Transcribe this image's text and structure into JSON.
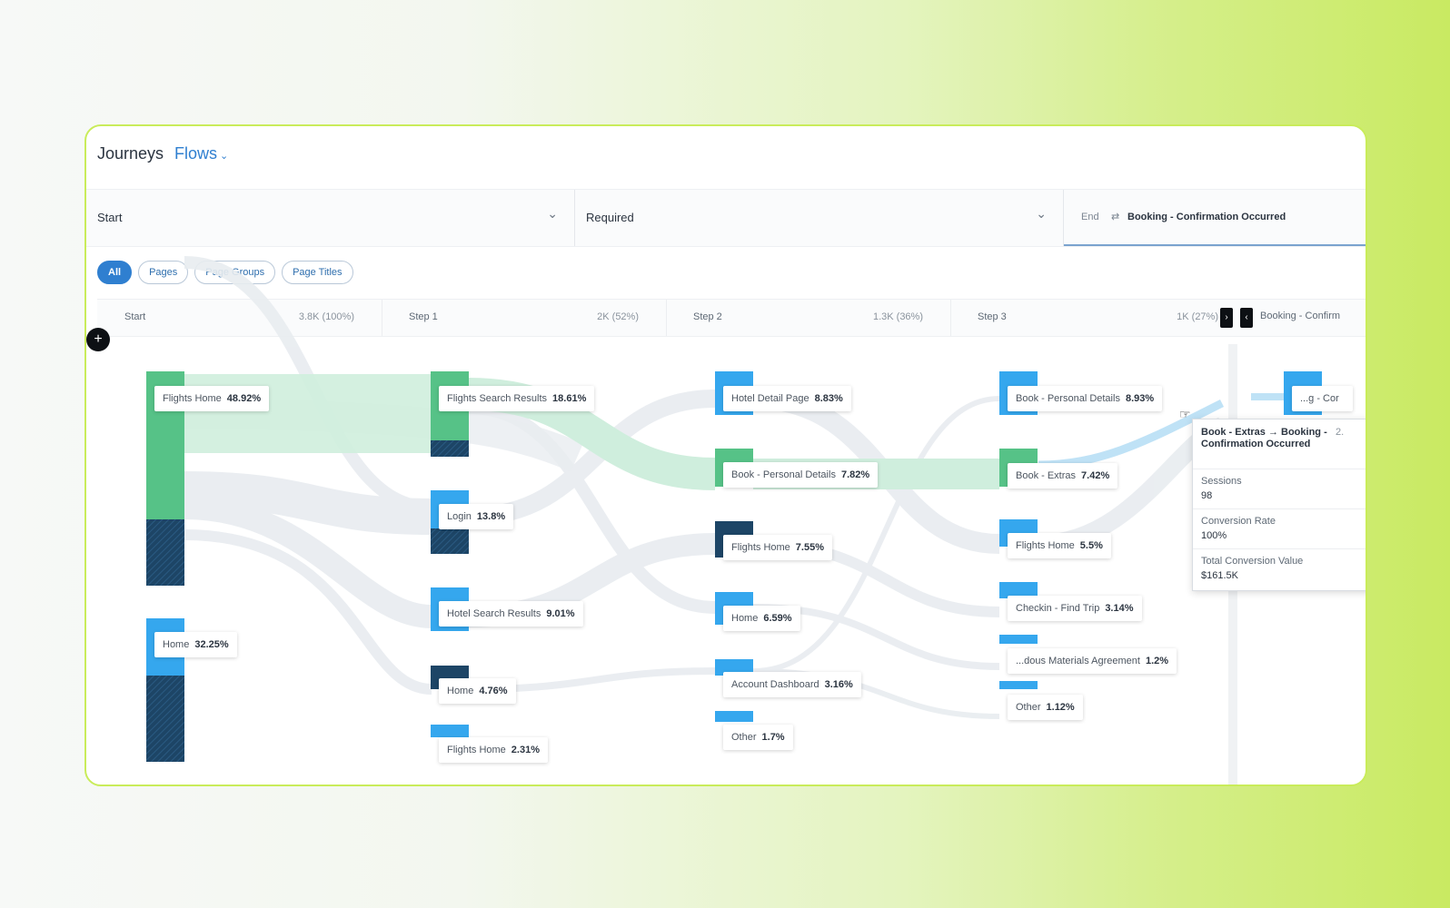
{
  "header": {
    "title": "Journeys",
    "mode_label": "Flows"
  },
  "filters": {
    "start_label": "Start",
    "required_label": "Required",
    "end_prefix": "End",
    "end_value": "Booking - Confirmation Occurred"
  },
  "pills": [
    {
      "label": "All",
      "active": true
    },
    {
      "label": "Pages",
      "active": false
    },
    {
      "label": "Page Groups",
      "active": false
    },
    {
      "label": "Page Titles",
      "active": false
    }
  ],
  "steps": [
    {
      "name": "Start",
      "count": "3.8K (100%)"
    },
    {
      "name": "Step 1",
      "count": "2K (52%)"
    },
    {
      "name": "Step 2",
      "count": "1.3K (36%)"
    },
    {
      "name": "Step 3",
      "count": "1K (27%)"
    }
  ],
  "end_column_label": "Booking - Confirm",
  "columns": [
    {
      "nodes": [
        {
          "name": "Flights Home",
          "pct": "48.92%"
        },
        {
          "name": "Home",
          "pct": "32.25%"
        }
      ]
    },
    {
      "nodes": [
        {
          "name": "Flights Search Results",
          "pct": "18.61%"
        },
        {
          "name": "Login",
          "pct": "13.8%"
        },
        {
          "name": "Hotel Search Results",
          "pct": "9.01%"
        },
        {
          "name": "Home",
          "pct": "4.76%"
        },
        {
          "name": "Flights Home",
          "pct": "2.31%"
        }
      ]
    },
    {
      "nodes": [
        {
          "name": "Hotel Detail Page",
          "pct": "8.83%"
        },
        {
          "name": "Book - Personal Details",
          "pct": "7.82%"
        },
        {
          "name": "Flights Home",
          "pct": "7.55%"
        },
        {
          "name": "Home",
          "pct": "6.59%"
        },
        {
          "name": "Account Dashboard",
          "pct": "3.16%"
        },
        {
          "name": "Other",
          "pct": "1.7%"
        }
      ]
    },
    {
      "nodes": [
        {
          "name": "Book - Personal Details",
          "pct": "8.93%"
        },
        {
          "name": "Book - Extras",
          "pct": "7.42%"
        },
        {
          "name": "Flights Home",
          "pct": "5.5%"
        },
        {
          "name": "Checkin - Find Trip",
          "pct": "3.14%"
        },
        {
          "name": "...dous Materials Agreement",
          "pct": "1.2%"
        },
        {
          "name": "Other",
          "pct": "1.12%"
        }
      ]
    },
    {
      "nodes": [
        {
          "name": "...g - Cor",
          "pct": ""
        }
      ]
    }
  ],
  "tooltip": {
    "title": "Book - Extras → Booking - Confirmation Occurred",
    "side": "2.",
    "sessions_label": "Sessions",
    "sessions_value": "98",
    "conv_rate_label": "Conversion Rate",
    "conv_rate_value": "100%",
    "conv_value_label": "Total Conversion Value",
    "conv_value_value": "$161.5K"
  },
  "colors": {
    "green": "#56c287",
    "blue": "#35a7ee",
    "dark_blue": "#1d4566",
    "accent": "#2f7fd0",
    "card_border": "#c9ec5a"
  },
  "icons": {
    "add": "plus-icon",
    "next": "chevron-right-icon",
    "prev": "chevron-left-icon",
    "dropdown": "chevron-down-icon",
    "swap": "swap-icon"
  }
}
